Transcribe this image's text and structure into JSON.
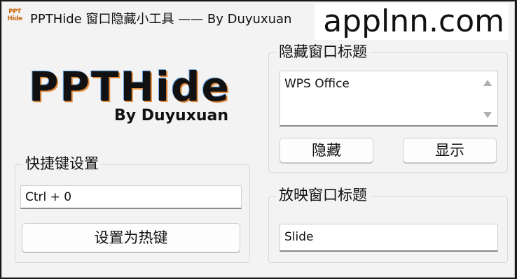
{
  "titlebar": {
    "icon_line1": "PPT",
    "icon_line2": "Hide",
    "title": "PPTHide 窗口隐藏小工具 —— By Duyuxuan",
    "watermark": "applnn.com"
  },
  "logo": {
    "title": "PPTHide",
    "byline": "By Duyuxuan"
  },
  "hotkey": {
    "legend": "快捷键设置",
    "value": "Ctrl + 0",
    "set_button": "设置为热键"
  },
  "hide_group": {
    "legend": "隐藏窗口标题",
    "value": "WPS Office",
    "hide_button": "隐藏",
    "show_button": "显示"
  },
  "show_group": {
    "legend": "放映窗口标题",
    "value": "Slide"
  }
}
